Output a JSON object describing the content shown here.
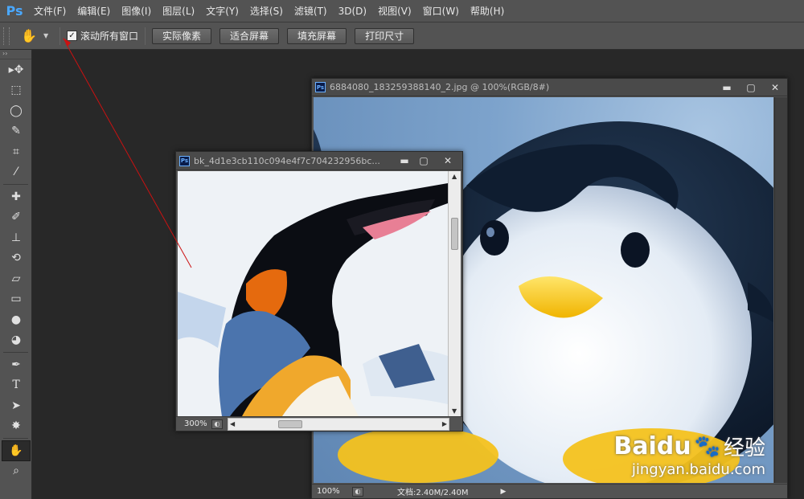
{
  "app": {
    "logo": "Ps"
  },
  "menu": [
    "文件(F)",
    "编辑(E)",
    "图像(I)",
    "图层(L)",
    "文字(Y)",
    "选择(S)",
    "滤镜(T)",
    "3D(D)",
    "视图(V)",
    "窗口(W)",
    "帮助(H)"
  ],
  "options": {
    "checkbox_label": "滚动所有窗口",
    "checkbox_checked": true,
    "buttons": [
      "实际像素",
      "适合屏幕",
      "填充屏幕",
      "打印尺寸"
    ]
  },
  "toolbox": {
    "tools": [
      "move-tool",
      "marquee-tool",
      "lasso-tool",
      "quick-select-tool",
      "crop-tool",
      "eyedropper-tool",
      "healing-brush-tool",
      "brush-tool",
      "clone-stamp-tool",
      "history-brush-tool",
      "eraser-tool",
      "gradient-tool",
      "blur-tool",
      "dodge-tool",
      "pen-tool",
      "type-tool",
      "path-select-tool",
      "shape-tool",
      "hand-tool",
      "zoom-tool"
    ],
    "active": "hand-tool"
  },
  "windows": {
    "big": {
      "title": "6884080_183259388140_2.jpg @ 100%(RGB/8#)",
      "zoom": "100%",
      "doc_info": "文档:2.40M/2.40M"
    },
    "small": {
      "title": "bk_4d1e3cb110c094e4f7c704232956bc...",
      "zoom": "300%"
    }
  },
  "watermark": {
    "brand": "Baidu",
    "brand_cn": "经验",
    "url": "jingyan.baidu.com"
  },
  "colors": {
    "accent_red": "#cc1111",
    "ps_blue": "#4aa8ff",
    "ui_gray": "#535353"
  }
}
